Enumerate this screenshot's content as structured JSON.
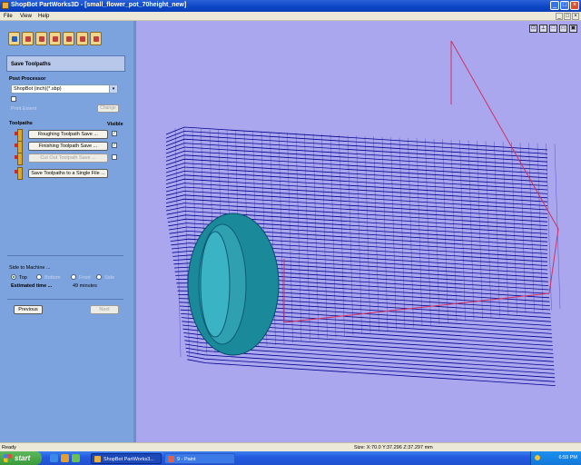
{
  "window": {
    "title": "ShopBot PartWorks3D - [small_flower_pot_70height_new]",
    "controls": [
      "_",
      "□",
      "×"
    ]
  },
  "menu": {
    "items": [
      "File",
      "View",
      "Help"
    ]
  },
  "panel": {
    "section_title": "Save Toolpaths",
    "post_processor_label": "Post Processor",
    "post_processor_value": "ShopBot (inch)(*.sbp)",
    "print_extents_label": "Print Extent",
    "change_button": "Change",
    "toolpaths_label": "Toolpaths",
    "visible_label": "Visible",
    "toolpaths": [
      {
        "label": "Roughing Toolpath Save ...",
        "visible": true,
        "enabled": true
      },
      {
        "label": "Finishing Toolpath Save ...",
        "visible": true,
        "enabled": true
      },
      {
        "label": "Cut Out Toolpath Save ...",
        "visible": false,
        "enabled": false
      }
    ],
    "save_single_button": "Save Toolpaths to a Single File ...",
    "side_label": "Side to Machine ...",
    "sides": [
      {
        "label": "Top",
        "selected": true
      },
      {
        "label": "Bottom",
        "selected": false
      },
      {
        "label": "Front",
        "selected": false
      },
      {
        "label": "Side",
        "selected": false
      }
    ],
    "estimated_label": "Estimated time ...",
    "estimated_value": "49 minutes",
    "previous_button": "Previous",
    "next_button": "Next"
  },
  "statusbar": {
    "left": "Ready",
    "size": "Size: X:70.0 Y:37.296 Z:37.297 mm"
  },
  "taskbar": {
    "start_label": "start",
    "tasks": [
      "ShopBot PartWorks3...",
      "9 - Paint"
    ],
    "clock": "6:59 PM"
  },
  "colors": {
    "panel_bg": "#7da3de",
    "viewport_bg": "#aaa7ef",
    "toolpath_line": "#00008b",
    "model_fill": "#2f8ea0",
    "bbox_line": "#d03060"
  }
}
